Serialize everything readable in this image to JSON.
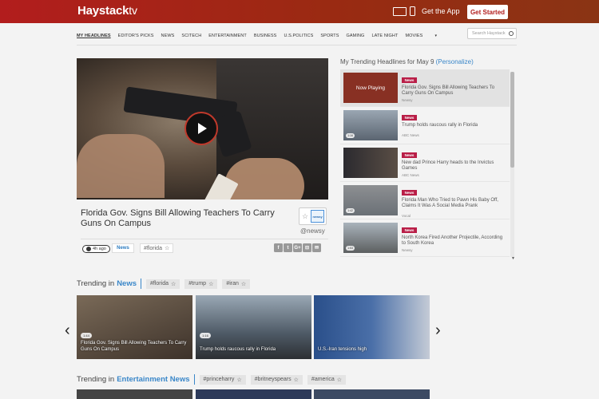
{
  "header": {
    "logo": "Haystack",
    "logo_suffix": "tv",
    "get_app": "Get the App",
    "get_started": "Get Started"
  },
  "nav": {
    "items": [
      "MY HEADLINES",
      "EDITOR'S PICKS",
      "NEWS",
      "SCITECH",
      "ENTERTAINMENT",
      "BUSINESS",
      "U.S.POLITICS",
      "SPORTS",
      "GAMING",
      "LATE NIGHT",
      "MOVIES"
    ],
    "more": "▾",
    "search_placeholder": "Search Haystack"
  },
  "player": {
    "headline": "Florida Gov. Signs Bill Allowing Teachers To Carry Guns On Campus",
    "source_logo": "newsy",
    "handle": "@newsy",
    "time_ago": "4h ago",
    "category": "News",
    "hashtag": "#florida",
    "share_icons": [
      "facebook-icon",
      "twitter-icon",
      "google-plus-icon",
      "share-icon",
      "email-icon"
    ]
  },
  "trending": {
    "title": "My Trending Headlines for May 9",
    "personalize": "(Personalize)",
    "items": [
      {
        "badge": "News",
        "overlay": "Now Playing",
        "title": "Florida Gov. Signs Bill Allowing Teachers To Carry Guns On Campus",
        "source": "Newsy",
        "dur": ""
      },
      {
        "badge": "News",
        "overlay": "",
        "title": "Trump holds raucous rally in Florida",
        "source": "ABC News",
        "dur": "1:16"
      },
      {
        "badge": "News",
        "overlay": "",
        "title": "New dad Prince Harry heads to the Invictus Games",
        "source": "ABC News",
        "dur": ""
      },
      {
        "badge": "News",
        "overlay": "",
        "title": "Florida Man Who Tried to Pawn His Baby Off, Claims It Was A Social Media Prank",
        "source": "Vocal",
        "dur": "1:42"
      },
      {
        "badge": "News",
        "overlay": "",
        "title": "North Korea Fired Another Projectile, According to South Korea",
        "source": "Newsy",
        "dur": "1:53"
      }
    ],
    "colors": {
      "badge": "#b91e47",
      "accent": "#3a87c9"
    }
  },
  "trending_news": {
    "prefix": "Trending in",
    "category": "News",
    "tags": [
      "#florida",
      "#trump",
      "#iran"
    ],
    "cards": [
      {
        "caption": "Florida Gov. Signs Bill Allowing Teachers To Carry Guns On Campus",
        "dur": "1:44"
      },
      {
        "caption": "Trump holds raucous rally in Florida",
        "dur": "1:16"
      },
      {
        "caption": "U.S.-Iran tensions high",
        "dur": ""
      }
    ],
    "prev": "‹",
    "next": "›"
  },
  "trending_entertainment": {
    "prefix": "Trending in",
    "category": "Entertainment News",
    "tags": [
      "#princeharry",
      "#britneyspears",
      "#america"
    ]
  }
}
